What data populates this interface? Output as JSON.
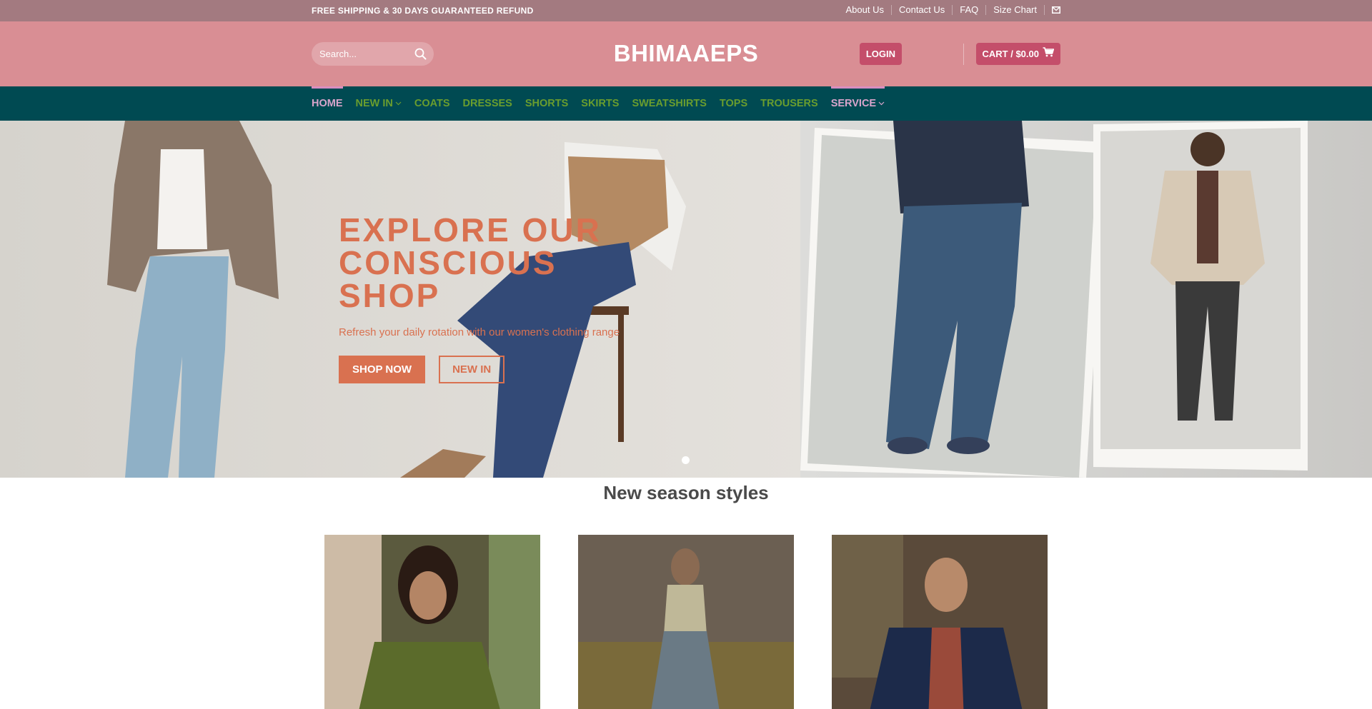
{
  "topbar": {
    "promo": "FREE SHIPPING & 30 DAYS GUARANTEED REFUND",
    "links": [
      "About Us",
      "Contact Us",
      "FAQ",
      "Size Chart"
    ],
    "mail_icon": "mail-icon"
  },
  "header": {
    "search_placeholder": "Search...",
    "search_icon": "search-icon",
    "logo": "BHIMAAEPS",
    "login_label": "LOGIN",
    "cart_label": "CART / $0.00",
    "cart_icon": "cart-icon"
  },
  "nav": {
    "items": [
      {
        "label": "HOME",
        "active": true
      },
      {
        "label": "NEW IN",
        "dropdown": true
      },
      {
        "label": "COATS"
      },
      {
        "label": "DRESSES"
      },
      {
        "label": "SHORTS"
      },
      {
        "label": "SKIRTS"
      },
      {
        "label": "SWEATSHIRTS"
      },
      {
        "label": "TOPS"
      },
      {
        "label": "TROUSERS"
      },
      {
        "label": "SERVICE",
        "dropdown": true
      }
    ]
  },
  "hero": {
    "title_lines": [
      "EXPLORE OUR",
      "CONSCIOUS",
      "SHOP"
    ],
    "subtitle": "Refresh your daily rotation with our women's clothing range",
    "primary_button": "SHOP NOW",
    "secondary_button": "NEW IN",
    "slide_count": 1
  },
  "section": {
    "title": "New season styles"
  },
  "colors": {
    "topbar": "#a37a80",
    "header": "#d98e94",
    "nav": "#004a52",
    "nav_text": "#6a9d2e",
    "nav_active": "#d9a5cc",
    "accent_button": "#c44e6a",
    "hero_accent": "#d97150"
  }
}
